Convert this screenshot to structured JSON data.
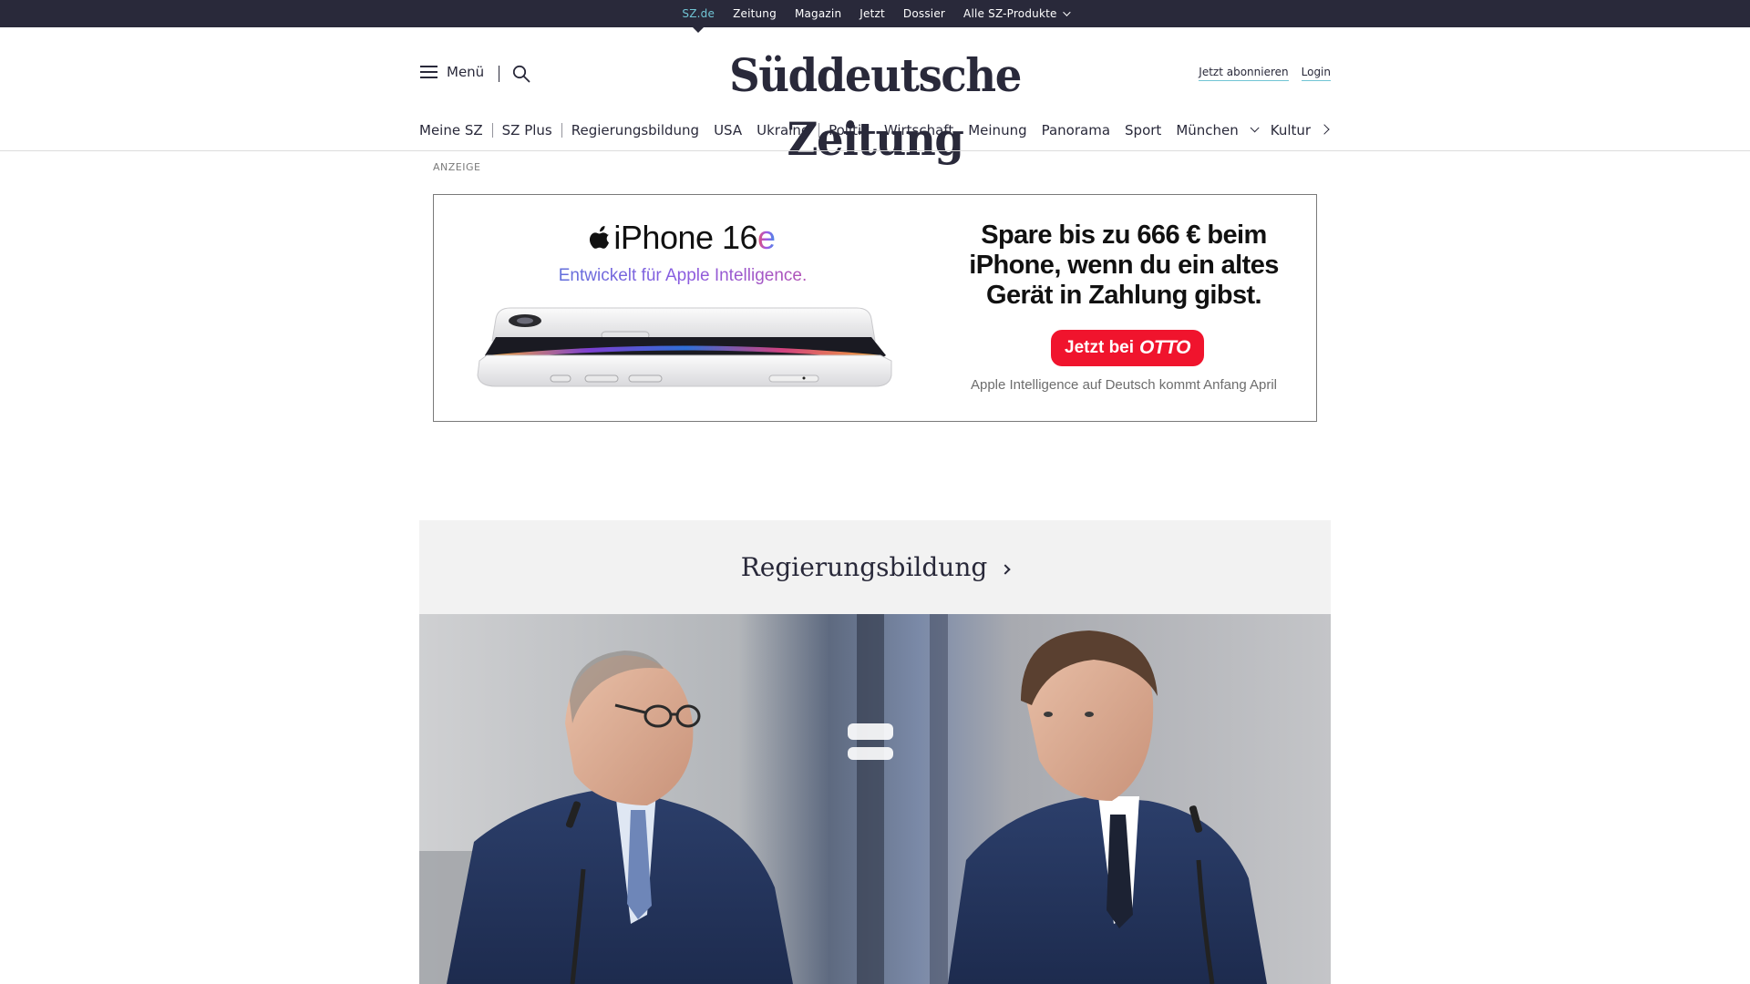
{
  "topbar": {
    "items": [
      {
        "label": "SZ.de",
        "active": true
      },
      {
        "label": "Zeitung"
      },
      {
        "label": "Magazin"
      },
      {
        "label": "Jetzt"
      },
      {
        "label": "Dossier"
      },
      {
        "label": "Alle SZ-Produkte"
      }
    ]
  },
  "header": {
    "menu_label": "Menü",
    "logo": "Süddeutsche Zeitung",
    "subscribe_label": "Jetzt abonnieren",
    "login_label": "Login"
  },
  "nav": {
    "items": [
      "Meine SZ",
      "SZ Plus",
      "Regierungsbildung",
      "USA",
      "Ukraine",
      "Politik",
      "Wirtschaft",
      "Meinung",
      "Panorama",
      "Sport",
      "München",
      "Kultur"
    ]
  },
  "ad": {
    "label": "ANZEIGE",
    "product_name": "iPhone 16",
    "product_suffix": "e",
    "tagline": "Entwickelt für Apple Intelligence.",
    "headline_line1": "Spare bis zu 666 € beim",
    "headline_line2": "iPhone, wenn du ein altes",
    "headline_line3": "Gerät in Zahlung gibst.",
    "cta_label": "Jetzt bei",
    "cta_brand": "OTTO",
    "disclaimer": "Apple Intelligence auf Deutsch kommt Anfang April"
  },
  "topic": {
    "title": "Regierungsbildung"
  },
  "colors": {
    "brand_dark": "#29293a",
    "accent_teal": "#71c5d5",
    "otto_red": "#f0142d",
    "topic_bg": "#f2f2f2"
  }
}
